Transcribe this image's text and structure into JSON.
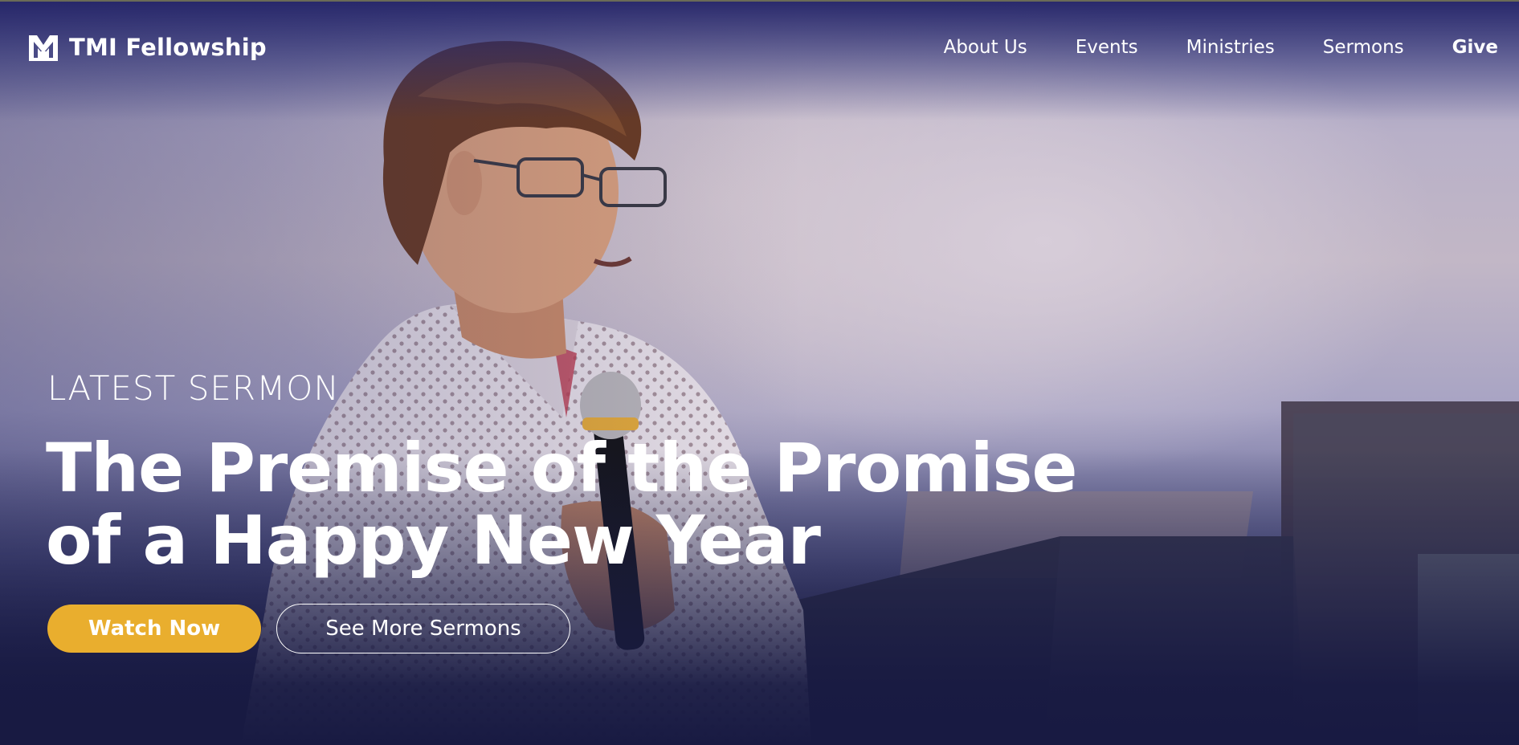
{
  "brand": {
    "name": "TMI Fellowship",
    "logo_icon": "tmi-logo-icon"
  },
  "nav": {
    "items": [
      {
        "label": "About Us"
      },
      {
        "label": "Events"
      },
      {
        "label": "Ministries"
      },
      {
        "label": "Sermons"
      },
      {
        "label": "Give"
      }
    ]
  },
  "hero": {
    "eyebrow": "LATEST SERMON",
    "title_line1": "The Premise of the Promise",
    "title_line2": "of a Happy New Year",
    "primary_button": "Watch Now",
    "secondary_button": "See More Sermons",
    "background_image": "preacher-speaking-into-microphone-photo"
  },
  "colors": {
    "accent": "#e9ae2e",
    "background_dark": "#1b1d45",
    "text": "#ffffff"
  }
}
